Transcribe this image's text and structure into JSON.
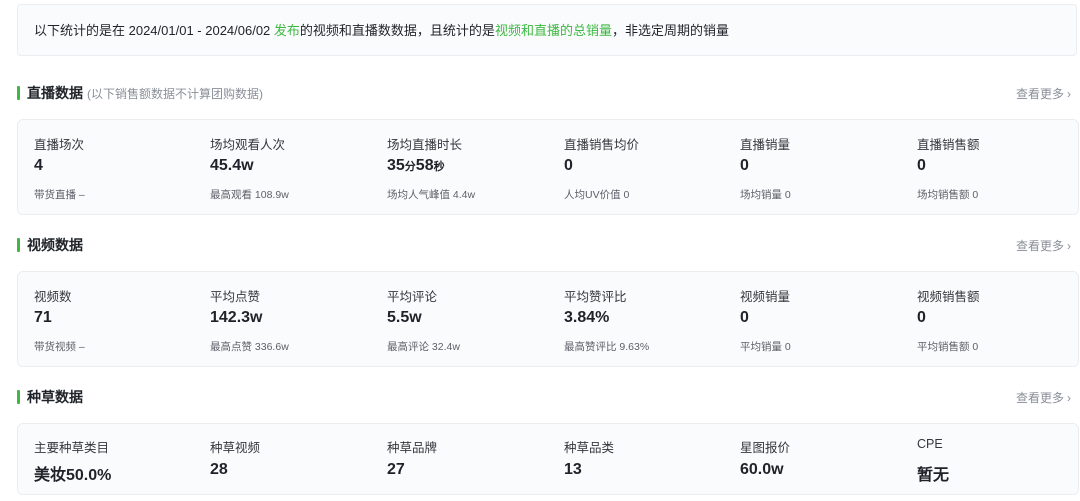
{
  "notice": {
    "prefix": "以下统计的是在 2024/01/01 - 2024/06/02 ",
    "highlight1": "发布",
    "middle": "的视频和直播数数据，且统计的是",
    "highlight2": "视频和直播的总销量",
    "suffix": "，非选定周期的销量"
  },
  "more_label": "查看更多",
  "live": {
    "title": "直播数据",
    "subtitle": "(以下销售额数据不计算团购数据)",
    "metrics": [
      {
        "label": "直播场次",
        "value": "4",
        "sub": "带货直播 –"
      },
      {
        "label": "场均观看人次",
        "value": "45.4w",
        "sub": "最高观看 108.9w"
      },
      {
        "label": "场均直播时长",
        "v1": "35",
        "u1": "分",
        "v2": "58",
        "u2": "秒",
        "sub": "场均人气峰值 4.4w"
      },
      {
        "label": "直播销售均价",
        "value": "0",
        "sub": "人均UV价值 0"
      },
      {
        "label": "直播销量",
        "value": "0",
        "sub": "场均销量 0"
      },
      {
        "label": "直播销售额",
        "value": "0",
        "sub": "场均销售额 0"
      }
    ]
  },
  "video": {
    "title": "视频数据",
    "metrics": [
      {
        "label": "视频数",
        "value": "71",
        "sub": "带货视频 –"
      },
      {
        "label": "平均点赞",
        "value": "142.3w",
        "sub": "最高点赞 336.6w"
      },
      {
        "label": "平均评论",
        "value": "5.5w",
        "sub": "最高评论 32.4w"
      },
      {
        "label": "平均赞评比",
        "value": "3.84%",
        "sub": "最高赞评比 9.63%"
      },
      {
        "label": "视频销量",
        "value": "0",
        "sub": "平均销量 0"
      },
      {
        "label": "视频销售额",
        "value": "0",
        "sub": "平均销售额 0"
      }
    ]
  },
  "seed": {
    "title": "种草数据",
    "metrics": [
      {
        "label": "主要种草类目",
        "value": "美妆50.0%"
      },
      {
        "label": "种草视频",
        "value": "28"
      },
      {
        "label": "种草品牌",
        "value": "27"
      },
      {
        "label": "种草品类",
        "value": "13"
      },
      {
        "label": "星图报价",
        "value": "60.0w"
      },
      {
        "label": "CPE",
        "value": "暂无"
      }
    ]
  },
  "colors": {
    "accent": "#3db842",
    "card_bg": "#fafbfc",
    "border": "#ebedf0"
  }
}
